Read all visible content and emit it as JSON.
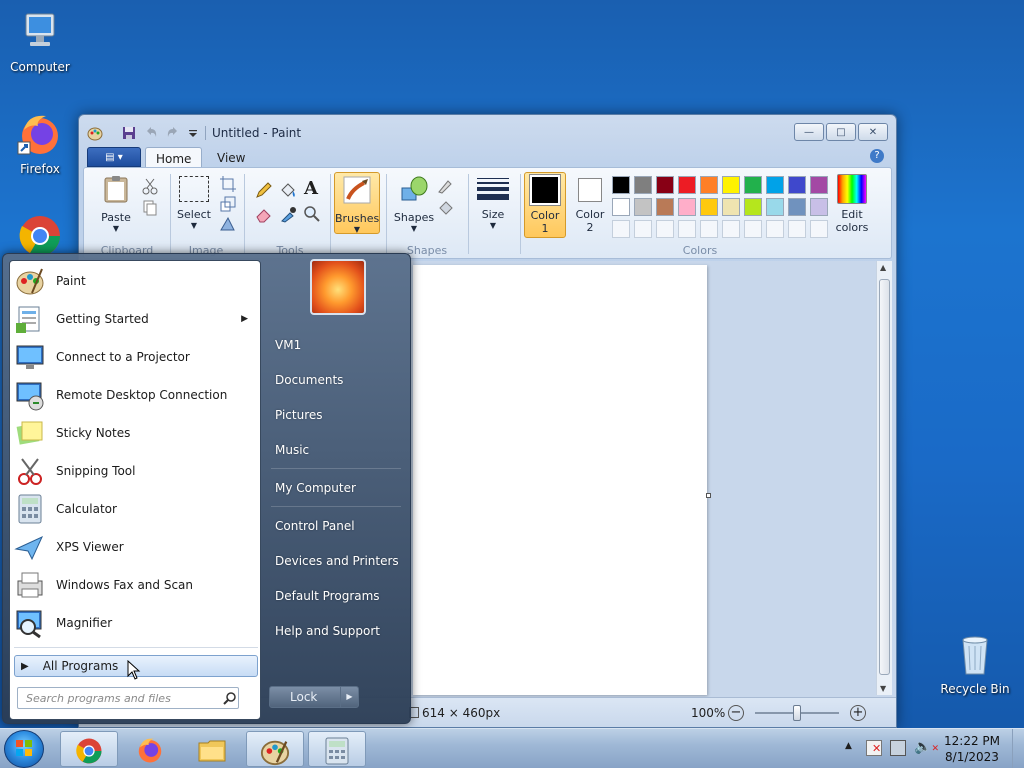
{
  "desktop": {
    "icons": [
      {
        "label": "Computer"
      },
      {
        "label": "Firefox"
      },
      {
        "label": "Recycle Bin"
      }
    ]
  },
  "paint": {
    "title": "Untitled - Paint",
    "tabs": [
      "Home",
      "View"
    ],
    "ribbon": {
      "paste": "Paste",
      "select": "Select",
      "brushes": "Brushes",
      "shapes": "Shapes",
      "size": "Size",
      "color1": "Color\n1",
      "color1_a": "Color",
      "color1_b": "1",
      "color2_a": "Color",
      "color2_b": "2",
      "edit_colors_a": "Edit",
      "edit_colors_b": "colors",
      "groups": {
        "clipboard": "Clipboard",
        "image": "Image",
        "tools": "Tools",
        "shapes": "Shapes",
        "colors": "Colors"
      }
    },
    "palette_row1": [
      "#000000",
      "#7f7f7f",
      "#880015",
      "#ed1c24",
      "#ff7f27",
      "#fff200",
      "#22b14c",
      "#00a2e8",
      "#3f48cc",
      "#a349a4"
    ],
    "palette_row2": [
      "#ffffff",
      "#c3c3c3",
      "#b97a57",
      "#ffaec9",
      "#ffc90e",
      "#efe4b0",
      "#b5e61d",
      "#99d9ea",
      "#7092be",
      "#c8bfe7"
    ],
    "status": {
      "size": "614 × 460px",
      "zoom": "100%"
    }
  },
  "start_menu": {
    "programs": [
      {
        "label": "Paint"
      },
      {
        "label": "Getting Started"
      },
      {
        "label": "Connect to a Projector"
      },
      {
        "label": "Remote Desktop Connection"
      },
      {
        "label": "Sticky Notes"
      },
      {
        "label": "Snipping Tool"
      },
      {
        "label": "Calculator"
      },
      {
        "label": "XPS Viewer"
      },
      {
        "label": "Windows Fax and Scan"
      },
      {
        "label": "Magnifier"
      }
    ],
    "all_programs": "All Programs",
    "search_placeholder": "Search programs and files",
    "right_items": [
      {
        "label": "VM1"
      },
      {
        "label": "Documents"
      },
      {
        "label": "Pictures"
      },
      {
        "label": "Music"
      },
      {
        "label": "My Computer"
      },
      {
        "label": "Control Panel"
      },
      {
        "label": "Devices and Printers"
      },
      {
        "label": "Default Programs"
      },
      {
        "label": "Help and Support"
      }
    ],
    "lock": "Lock"
  },
  "taskbar": {
    "time": "12:22 PM",
    "date": "8/1/2023"
  }
}
